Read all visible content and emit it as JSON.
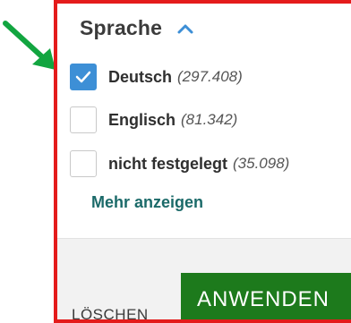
{
  "colors": {
    "highlight_border": "#e41b1b",
    "annotation_arrow": "#12a540",
    "checkbox_checked": "#3d8fd6",
    "link": "#1b6a69",
    "apply_button": "#1d7a1c"
  },
  "filter": {
    "title": "Sprache",
    "collapse_icon": "chevron-up-icon",
    "options": [
      {
        "label": "Deutsch",
        "count": "(297.408)",
        "checked": true
      },
      {
        "label": "Englisch",
        "count": "(81.342)",
        "checked": false
      },
      {
        "label": "nicht festgelegt",
        "count": "(35.098)",
        "checked": false
      }
    ],
    "more_label": "Mehr anzeigen"
  },
  "footer": {
    "clear_label": "LÖSCHEN",
    "apply_label": "ANWENDEN"
  }
}
